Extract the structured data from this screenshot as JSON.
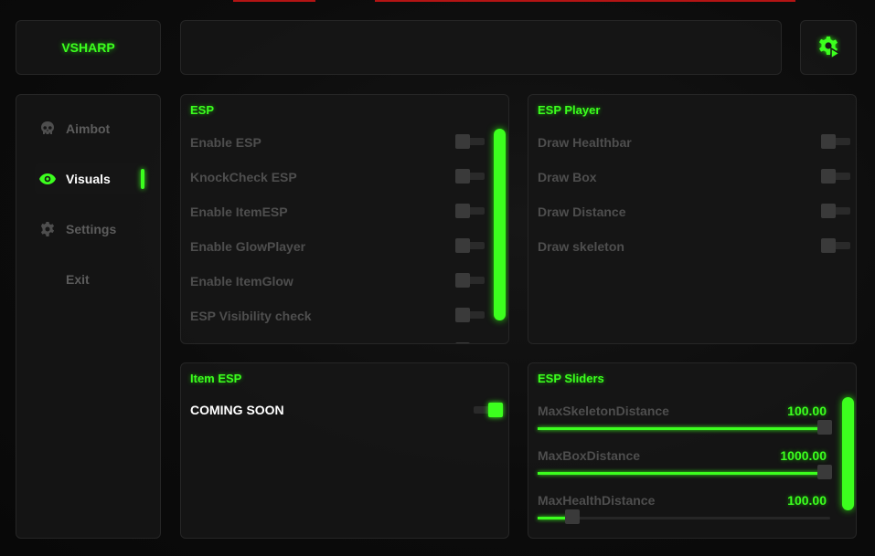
{
  "app": {
    "title": "VSHARP"
  },
  "colors": {
    "accent": "#3cff1e",
    "background": "#0b0b0b",
    "panel": "#161616",
    "muted_text": "#4e4e4e"
  },
  "header": {
    "settings_icon": "gear-play-icon"
  },
  "sidebar": {
    "items": [
      {
        "label": "Aimbot",
        "icon": "skull-icon",
        "active": false
      },
      {
        "label": "Visuals",
        "icon": "eye-icon",
        "active": true
      },
      {
        "label": "Settings",
        "icon": "gear-icon",
        "active": false
      },
      {
        "label": "Exit",
        "icon": "",
        "active": false
      }
    ]
  },
  "esp": {
    "title": "ESP",
    "options": [
      {
        "label": "Enable ESP",
        "on": false
      },
      {
        "label": "KnockCheck  ESP",
        "on": false
      },
      {
        "label": "Enable ItemESP",
        "on": false
      },
      {
        "label": "Enable GlowPlayer",
        "on": false
      },
      {
        "label": "Enable ItemGlow",
        "on": false
      },
      {
        "label": "ESP Visibility check",
        "on": false
      }
    ]
  },
  "esp_player": {
    "title": "ESP Player",
    "options": [
      {
        "label": "Draw Healthbar",
        "on": false
      },
      {
        "label": "Draw Box",
        "on": false
      },
      {
        "label": "Draw Distance",
        "on": false
      },
      {
        "label": "Draw skeleton",
        "on": false
      }
    ]
  },
  "item_esp": {
    "title": "Item ESP",
    "message": "COMING SOON",
    "toggle_on": true
  },
  "esp_sliders": {
    "title": "ESP Sliders",
    "sliders": [
      {
        "label": "MaxSkeletonDistance",
        "value": "100.00",
        "fraction": 0.98
      },
      {
        "label": "MaxBoxDistance",
        "value": "1000.00",
        "fraction": 0.98
      },
      {
        "label": "MaxHealthDistance",
        "value": "100.00",
        "fraction": 0.12
      }
    ]
  }
}
